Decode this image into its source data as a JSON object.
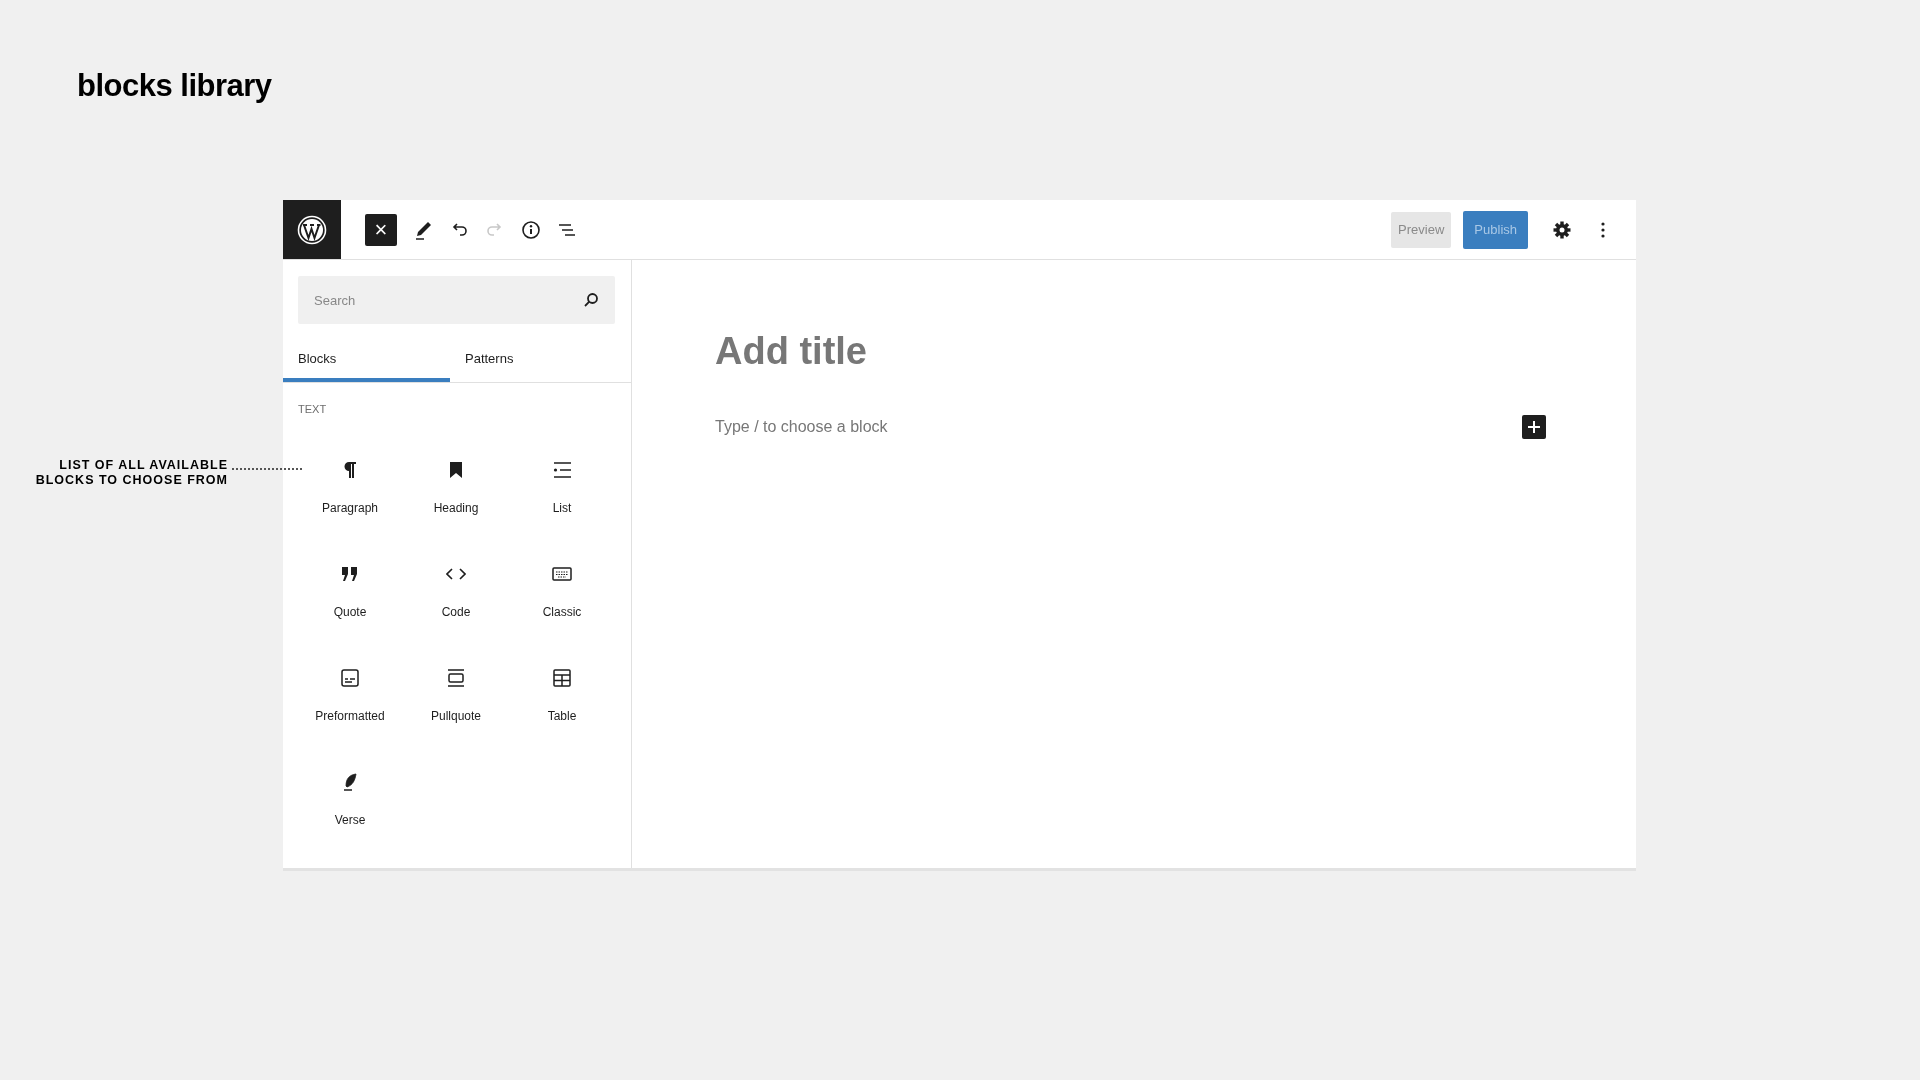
{
  "slide_title": "blocks library",
  "annotation": {
    "lines": [
      "LIST OF ALL AVAILABLE",
      "BLOCKS TO CHOOSE FROM"
    ]
  },
  "toolbar": {
    "close_label": "×",
    "preview": "Preview",
    "publish": "Publish",
    "redo_disabled": true
  },
  "search": {
    "placeholder": "Search"
  },
  "tabs": [
    {
      "label": "Blocks",
      "selected": true
    },
    {
      "label": "Patterns",
      "selected": false
    }
  ],
  "category": "TEXT",
  "blocks": [
    {
      "label": "Paragraph",
      "kind": "paragraph"
    },
    {
      "label": "Heading",
      "kind": "heading"
    },
    {
      "label": "List",
      "kind": "list"
    },
    {
      "label": "Quote",
      "kind": "quote"
    },
    {
      "label": "Code",
      "kind": "code"
    },
    {
      "label": "Classic",
      "kind": "classic"
    },
    {
      "label": "Preformatted",
      "kind": "preformatted"
    },
    {
      "label": "Pullquote",
      "kind": "pullquote"
    },
    {
      "label": "Table",
      "kind": "table"
    },
    {
      "label": "Verse",
      "kind": "verse"
    }
  ],
  "editor": {
    "title_placeholder": "Add title",
    "block_placeholder": "Type / to choose a block"
  }
}
